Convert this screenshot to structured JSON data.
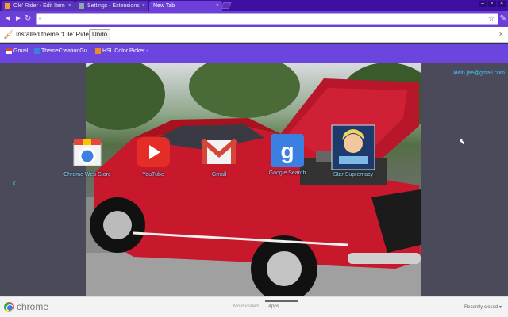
{
  "tabs": [
    {
      "label": "Ole' Rider - Edit Item",
      "close": "×",
      "state": "inactive"
    },
    {
      "label": "Settings - Extensions",
      "close": "×",
      "state": "inactive"
    },
    {
      "label": "New Tab",
      "close": "×",
      "state": "active"
    }
  ],
  "window_controls": {
    "minimize": "–",
    "maximize": "▫",
    "close": "×"
  },
  "toolbar": {
    "back": "◄",
    "forward": "►",
    "reload": "↻",
    "omnibox_value": "",
    "omnibox_placeholder": "",
    "star": "☆",
    "wrench": "✎"
  },
  "infobar": {
    "message": "Installed theme \"Ole' Rider\".",
    "undo_label": "Undo",
    "close": "×"
  },
  "bookmarks": [
    {
      "label": "Gmail",
      "icon": "gmail-icon",
      "color": "#d44638"
    },
    {
      "label": "ThemeCreationGu...",
      "icon": "docs-icon",
      "color": "#3b7fe2"
    },
    {
      "label": "HSL Color Picker -...",
      "icon": "color-icon",
      "color": "#f08a24"
    }
  ],
  "user": {
    "email": "klein.jae@gmail.com"
  },
  "apps": [
    {
      "label": "Chrome Web Store",
      "icon": "web-store-icon"
    },
    {
      "label": "YouTube",
      "icon": "youtube-icon"
    },
    {
      "label": "Gmail",
      "icon": "gmail-icon"
    },
    {
      "label": "Google Search",
      "icon": "google-search-icon"
    },
    {
      "label": "Star Supremacy",
      "icon": "star-supremacy-icon"
    }
  ],
  "footer": {
    "brand": "chrome",
    "tab_most_visited": "Most visited",
    "tab_apps": "Apps",
    "recently_closed": "Recently closed ▾"
  },
  "colors": {
    "accent": "#6d3fd9",
    "tab_strip": "#3f0fa2",
    "label": "#8cd4ff"
  }
}
